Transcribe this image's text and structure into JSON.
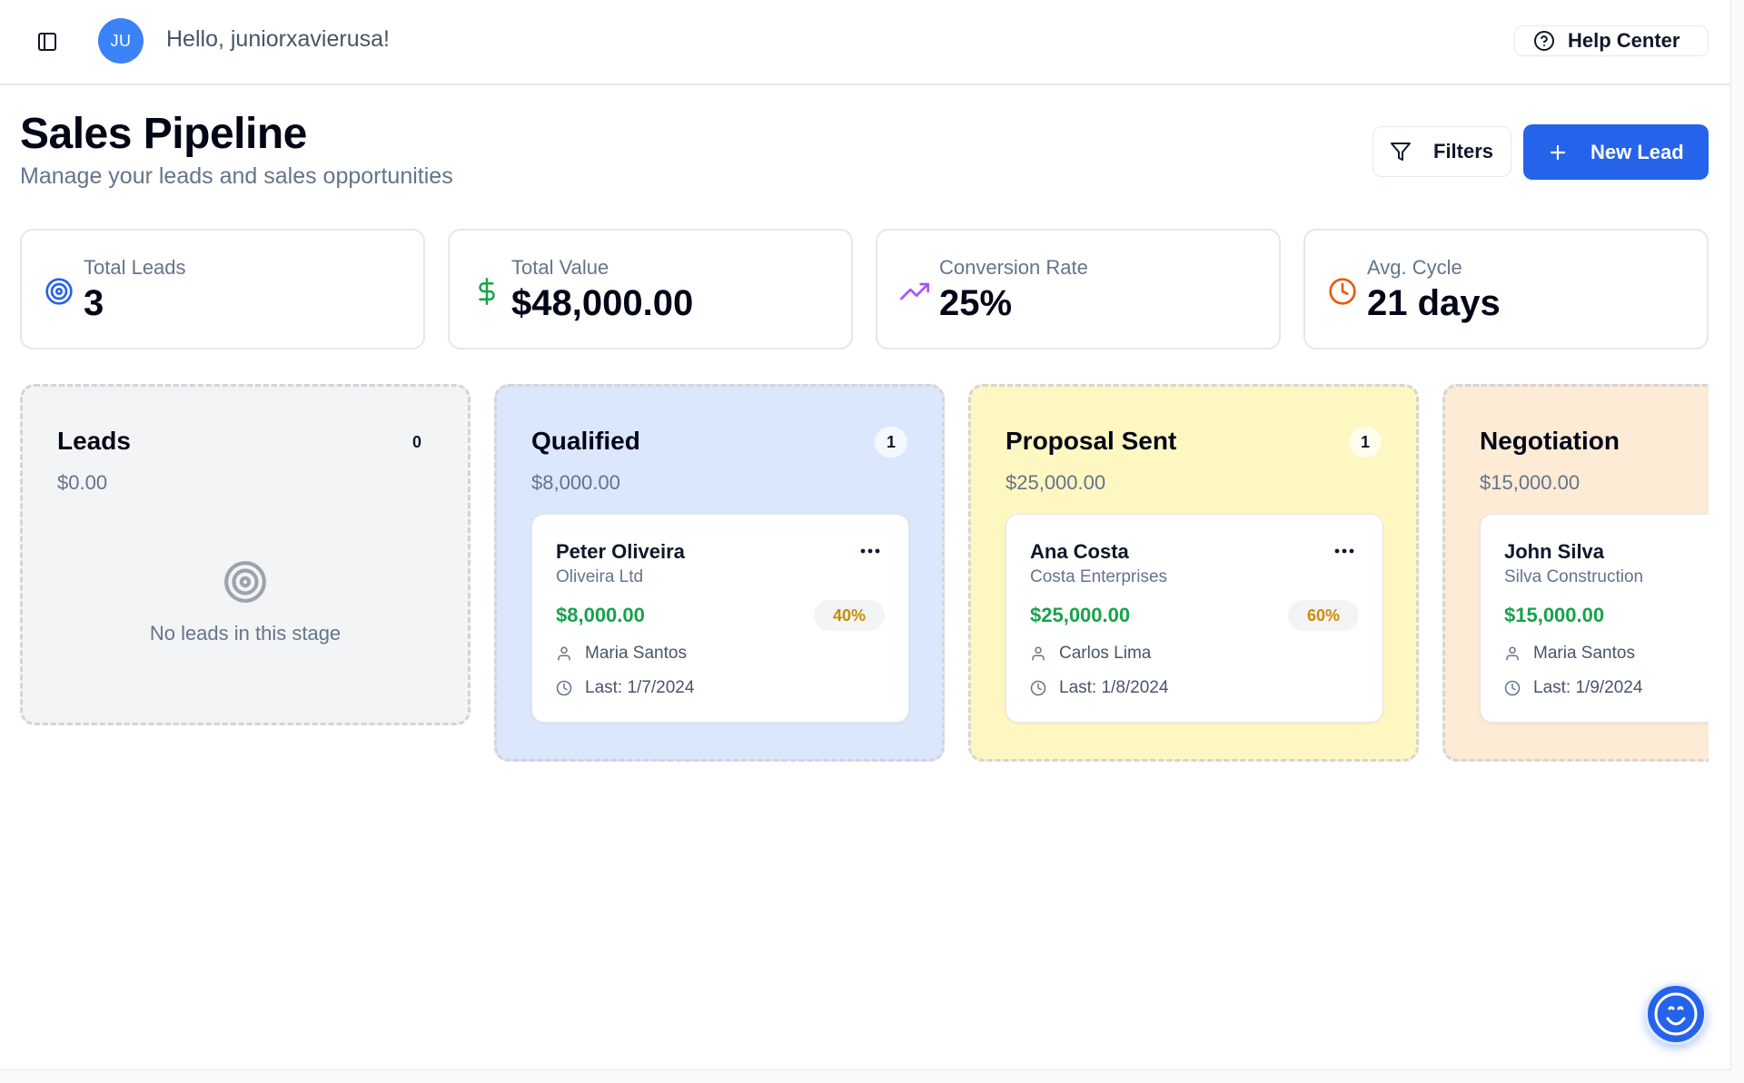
{
  "topbar": {
    "avatar_initials": "JU",
    "greeting": "Hello, juniorxavierusa!",
    "help_label": "Help Center"
  },
  "header": {
    "title": "Sales Pipeline",
    "subtitle": "Manage your leads and sales opportunities",
    "filters_label": "Filters",
    "new_lead_label": "New Lead"
  },
  "stats": [
    {
      "label": "Total Leads",
      "value": "3",
      "icon": "target-icon",
      "color": "#2563eb"
    },
    {
      "label": "Total Value",
      "value": "$48,000.00",
      "icon": "dollar-icon",
      "color": "#16a34a"
    },
    {
      "label": "Conversion Rate",
      "value": "25%",
      "icon": "trending-up-icon",
      "color": "#a855f7"
    },
    {
      "label": "Avg. Cycle",
      "value": "21 days",
      "icon": "clock-icon",
      "color": "#ea580c"
    }
  ],
  "columns": [
    {
      "title": "Leads",
      "count": "0",
      "total": "$0.00",
      "color": "#f3f4f6",
      "empty_text": "No leads in this stage"
    },
    {
      "title": "Qualified",
      "count": "1",
      "total": "$8,000.00",
      "color": "#dbe7fd",
      "lead": {
        "name": "Peter Oliveira",
        "company": "Oliveira Ltd",
        "value": "$8,000.00",
        "probability": "40%",
        "owner": "Maria Santos",
        "last": "Last: 1/7/2024"
      }
    },
    {
      "title": "Proposal Sent",
      "count": "1",
      "total": "$25,000.00",
      "color": "#fef7c2",
      "lead": {
        "name": "Ana Costa",
        "company": "Costa Enterprises",
        "value": "$25,000.00",
        "probability": "60%",
        "owner": "Carlos Lima",
        "last": "Last: 1/8/2024"
      }
    },
    {
      "title": "Negotiation",
      "count": "",
      "total": "$15,000.00",
      "color": "#feebd5",
      "lead": {
        "name": "John Silva",
        "company": "Silva Construction",
        "value": "$15,000.00",
        "probability": "",
        "owner": "Maria Santos",
        "last": "Last: 1/9/2024"
      }
    }
  ],
  "colors": {
    "primary": "#2563eb",
    "money_green": "#16a34a",
    "probability_amber": "#ca8a04"
  }
}
